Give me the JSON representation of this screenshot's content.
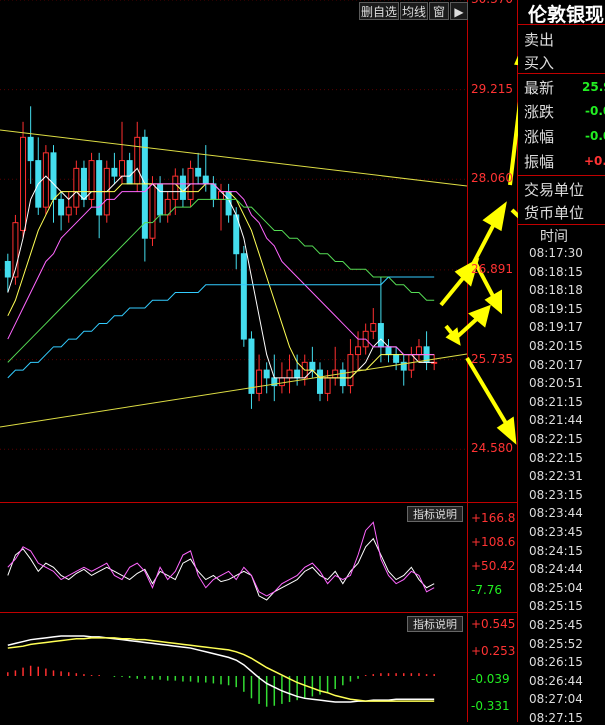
{
  "toolbar": {
    "remove_watch": "删自选",
    "ma": "均线",
    "window": "窗"
  },
  "price_axis": [
    "30.370",
    "29.215",
    "28.060",
    "26.891",
    "25.735",
    "24.580"
  ],
  "quote": {
    "title": "伦敦银现",
    "sell": "卖出",
    "buy": "买入",
    "latest_label": "最新",
    "latest_value": "25.9",
    "change_label": "涨跌",
    "change_value": "-0.0",
    "pct_label": "涨幅",
    "pct_value": "-0.0",
    "amp_label": "振幅",
    "amp_value": "+0.2",
    "unit_label": "交易单位",
    "currency_label": "货币单位"
  },
  "ticks": {
    "header": "时间",
    "times": [
      "08:17:30",
      "08:18:15",
      "08:18:18",
      "08:19:15",
      "08:19:17",
      "08:20:15",
      "08:20:17",
      "08:20:51",
      "08:21:15",
      "08:21:44",
      "08:22:15",
      "08:22:15",
      "08:22:31",
      "08:23:15",
      "08:23:44",
      "08:23:45",
      "08:24:15",
      "08:24:44",
      "08:25:04",
      "08:25:15",
      "08:25:45",
      "08:25:52",
      "08:26:15",
      "08:26:44",
      "08:27:04",
      "08:27:15"
    ]
  },
  "indicator_tag": "指标说明",
  "chart_data": [
    {
      "type": "candlestick",
      "ylim": [
        23.9,
        30.37
      ],
      "yticks": [
        30.37,
        29.215,
        28.06,
        26.891,
        25.735,
        24.58
      ],
      "candles": [
        [
          27.0,
          27.1,
          26.6,
          26.8
        ],
        [
          26.8,
          27.6,
          26.7,
          27.5
        ],
        [
          27.4,
          28.8,
          27.3,
          28.6
        ],
        [
          28.6,
          29.0,
          28.0,
          28.3
        ],
        [
          28.3,
          28.6,
          27.6,
          27.7
        ],
        [
          27.7,
          28.5,
          27.6,
          28.4
        ],
        [
          28.4,
          28.5,
          27.5,
          27.8
        ],
        [
          27.8,
          27.9,
          27.4,
          27.6
        ],
        [
          27.6,
          27.9,
          27.5,
          27.7
        ],
        [
          27.7,
          28.3,
          27.6,
          28.2
        ],
        [
          28.2,
          28.3,
          27.7,
          27.8
        ],
        [
          27.8,
          28.4,
          27.7,
          28.3
        ],
        [
          28.3,
          28.4,
          27.3,
          27.6
        ],
        [
          27.6,
          28.3,
          27.5,
          28.2
        ],
        [
          28.2,
          28.4,
          28.0,
          28.1
        ],
        [
          28.1,
          28.8,
          28.0,
          28.3
        ],
        [
          28.3,
          28.4,
          28.0,
          28.0
        ],
        [
          28.0,
          28.8,
          27.9,
          28.6
        ],
        [
          28.6,
          28.7,
          27.0,
          27.3
        ],
        [
          27.3,
          28.1,
          27.2,
          28.0
        ],
        [
          28.0,
          28.1,
          27.5,
          27.6
        ],
        [
          27.6,
          27.9,
          27.5,
          27.8
        ],
        [
          27.8,
          28.2,
          27.6,
          28.1
        ],
        [
          28.1,
          28.2,
          27.7,
          27.8
        ],
        [
          27.8,
          28.3,
          27.7,
          28.2
        ],
        [
          28.2,
          28.4,
          28.0,
          28.1
        ],
        [
          28.1,
          28.5,
          27.9,
          28.0
        ],
        [
          28.0,
          28.1,
          27.7,
          27.8
        ],
        [
          27.8,
          28.0,
          27.4,
          27.9
        ],
        [
          27.9,
          28.0,
          27.5,
          27.6
        ],
        [
          27.6,
          27.7,
          26.9,
          27.1
        ],
        [
          27.1,
          27.2,
          25.9,
          26.0
        ],
        [
          26.0,
          26.1,
          25.1,
          25.3
        ],
        [
          25.3,
          25.8,
          25.2,
          25.6
        ],
        [
          25.6,
          25.7,
          25.3,
          25.5
        ],
        [
          25.5,
          25.8,
          25.2,
          25.4
        ],
        [
          25.4,
          25.7,
          25.3,
          25.5
        ],
        [
          25.5,
          25.8,
          25.3,
          25.6
        ],
        [
          25.6,
          25.8,
          25.4,
          25.5
        ],
        [
          25.5,
          25.8,
          25.4,
          25.7
        ],
        [
          25.7,
          25.9,
          25.5,
          25.6
        ],
        [
          25.6,
          25.7,
          25.2,
          25.3
        ],
        [
          25.3,
          25.6,
          25.2,
          25.5
        ],
        [
          25.5,
          25.9,
          25.4,
          25.6
        ],
        [
          25.6,
          25.7,
          25.3,
          25.4
        ],
        [
          25.4,
          26.0,
          25.3,
          25.8
        ],
        [
          25.8,
          26.1,
          25.6,
          25.9
        ],
        [
          25.9,
          26.2,
          25.8,
          26.1
        ],
        [
          26.1,
          26.4,
          26.0,
          26.2
        ],
        [
          26.2,
          26.8,
          25.7,
          25.9
        ],
        [
          25.9,
          26.0,
          25.7,
          25.8
        ],
        [
          25.8,
          25.9,
          25.6,
          25.7
        ],
        [
          25.7,
          25.8,
          25.4,
          25.6
        ],
        [
          25.6,
          25.9,
          25.5,
          25.8
        ],
        [
          25.8,
          26.0,
          25.7,
          25.9
        ],
        [
          25.9,
          26.1,
          25.6,
          25.7
        ],
        [
          25.7,
          25.8,
          25.6,
          25.7
        ]
      ],
      "ma_lines": [
        {
          "color": "#ffffff",
          "values": [
            26.6,
            26.9,
            27.3,
            27.8,
            28.0,
            28.1,
            28.0,
            27.9,
            27.8,
            27.9,
            27.8,
            27.9,
            27.9,
            27.9,
            28.0,
            28.1,
            28.1,
            28.2,
            28.0,
            28.0,
            27.9,
            27.9,
            27.9,
            27.9,
            28.0,
            28.0,
            28.0,
            28.0,
            27.9,
            27.8,
            27.6,
            27.3,
            26.8,
            26.3,
            25.8,
            25.5,
            25.5,
            25.5,
            25.5,
            25.5,
            25.6,
            25.5,
            25.5,
            25.5,
            25.5,
            25.5,
            25.6,
            25.7,
            25.9,
            26.0,
            25.9,
            25.9,
            25.8,
            25.8,
            25.7,
            25.7,
            25.7
          ]
        },
        {
          "color": "#ffff55",
          "values": [
            26.3,
            26.5,
            26.8,
            27.1,
            27.4,
            27.6,
            27.8,
            27.9,
            27.9,
            27.9,
            27.9,
            27.9,
            27.9,
            27.9,
            27.9,
            28.0,
            28.0,
            28.0,
            28.0,
            28.0,
            28.0,
            28.0,
            28.0,
            27.9,
            27.9,
            27.9,
            28.0,
            28.0,
            27.9,
            27.9,
            27.8,
            27.6,
            27.4,
            27.1,
            26.8,
            26.5,
            26.2,
            25.9,
            25.7,
            25.6,
            25.6,
            25.5,
            25.5,
            25.5,
            25.5,
            25.5,
            25.6,
            25.6,
            25.7,
            25.8,
            25.8,
            25.8,
            25.8,
            25.8,
            25.8,
            25.8,
            25.8
          ]
        },
        {
          "color": "#ff66ff",
          "values": [
            26.0,
            26.2,
            26.4,
            26.6,
            26.8,
            27.0,
            27.1,
            27.3,
            27.4,
            27.5,
            27.6,
            27.7,
            27.7,
            27.8,
            27.8,
            27.9,
            27.9,
            27.9,
            27.9,
            28.0,
            28.0,
            28.0,
            28.0,
            28.0,
            28.0,
            28.0,
            28.0,
            28.0,
            27.9,
            27.9,
            27.9,
            27.8,
            27.6,
            27.5,
            27.3,
            27.2,
            27.0,
            26.9,
            26.8,
            26.7,
            26.6,
            26.5,
            26.4,
            26.3,
            26.2,
            26.1,
            26.0,
            26.0,
            25.9,
            25.9,
            25.9,
            25.9,
            25.8,
            25.8,
            25.8,
            25.8,
            25.8
          ]
        },
        {
          "color": "#55dd55",
          "values": [
            25.7,
            25.8,
            25.9,
            26.0,
            26.1,
            26.2,
            26.3,
            26.4,
            26.5,
            26.6,
            26.7,
            26.8,
            26.9,
            27.0,
            27.1,
            27.2,
            27.3,
            27.4,
            27.5,
            27.5,
            27.6,
            27.6,
            27.7,
            27.7,
            27.7,
            27.8,
            27.8,
            27.8,
            27.8,
            27.8,
            27.8,
            27.7,
            27.7,
            27.6,
            27.5,
            27.4,
            27.4,
            27.3,
            27.3,
            27.2,
            27.2,
            27.1,
            27.1,
            27.0,
            27.0,
            26.9,
            26.9,
            26.9,
            26.8,
            26.8,
            26.8,
            26.7,
            26.7,
            26.6,
            26.6,
            26.5,
            26.5
          ]
        },
        {
          "color": "#33ccff",
          "values": [
            25.5,
            25.6,
            25.6,
            25.7,
            25.7,
            25.8,
            25.9,
            25.9,
            26.0,
            26.0,
            26.1,
            26.1,
            26.2,
            26.2,
            26.3,
            26.3,
            26.4,
            26.4,
            26.4,
            26.5,
            26.5,
            26.5,
            26.6,
            26.6,
            26.6,
            26.6,
            26.7,
            26.7,
            26.7,
            26.7,
            26.7,
            26.7,
            26.7,
            26.7,
            26.7,
            26.7,
            26.7,
            26.7,
            26.7,
            26.7,
            26.7,
            26.7,
            26.7,
            26.7,
            26.7,
            26.7,
            26.7,
            26.7,
            26.7,
            26.7,
            26.8,
            26.8,
            26.8,
            26.8,
            26.8,
            26.8,
            26.8
          ]
        }
      ]
    },
    {
      "type": "line",
      "ylim": [
        -30,
        190
      ],
      "yticks": [
        166.8,
        108.6,
        50.42,
        -7.76
      ],
      "series": [
        {
          "color": "#ffffff",
          "values": [
            30,
            80,
            95,
            70,
            40,
            60,
            50,
            30,
            20,
            35,
            45,
            30,
            40,
            50,
            40,
            30,
            20,
            35,
            45,
            10,
            40,
            30,
            20,
            60,
            70,
            40,
            20,
            30,
            15,
            20,
            30,
            40,
            30,
            -20,
            -30,
            -10,
            0,
            10,
            20,
            40,
            50,
            30,
            20,
            40,
            10,
            40,
            60,
            100,
            120,
            80,
            40,
            20,
            30,
            50,
            20,
            0,
            10
          ]
        },
        {
          "color": "#ff66ff",
          "values": [
            50,
            70,
            100,
            90,
            60,
            50,
            40,
            20,
            30,
            40,
            50,
            40,
            50,
            60,
            30,
            20,
            50,
            60,
            40,
            0,
            50,
            20,
            40,
            80,
            90,
            30,
            0,
            20,
            30,
            40,
            20,
            50,
            30,
            -10,
            -20,
            -10,
            10,
            20,
            30,
            50,
            60,
            40,
            10,
            30,
            20,
            30,
            80,
            140,
            160,
            70,
            30,
            10,
            20,
            40,
            30,
            -10,
            0
          ]
        }
      ]
    },
    {
      "type": "bar_line",
      "ylim": [
        -0.43,
        0.58
      ],
      "yticks": [
        0.545,
        0.253,
        -0.039,
        -0.331
      ],
      "bars": [
        0.04,
        0.06,
        0.09,
        0.11,
        0.1,
        0.08,
        0.06,
        0.05,
        0.04,
        0.03,
        0.02,
        0.01,
        0.01,
        0.0,
        -0.01,
        -0.01,
        -0.02,
        -0.03,
        -0.03,
        -0.04,
        -0.04,
        -0.05,
        -0.05,
        -0.06,
        -0.06,
        -0.07,
        -0.07,
        -0.08,
        -0.09,
        -0.1,
        -0.12,
        -0.17,
        -0.24,
        -0.3,
        -0.33,
        -0.32,
        -0.3,
        -0.28,
        -0.26,
        -0.24,
        -0.22,
        -0.2,
        -0.18,
        -0.14,
        -0.1,
        -0.06,
        -0.03,
        0.01,
        0.02,
        0.03,
        0.03,
        0.03,
        0.03,
        0.03,
        0.03,
        0.02,
        0.02
      ],
      "series": [
        {
          "color": "#ffffff",
          "values": [
            0.33,
            0.35,
            0.37,
            0.39,
            0.4,
            0.41,
            0.42,
            0.43,
            0.43,
            0.43,
            0.43,
            0.42,
            0.42,
            0.41,
            0.4,
            0.39,
            0.38,
            0.37,
            0.36,
            0.35,
            0.34,
            0.33,
            0.32,
            0.31,
            0.3,
            0.28,
            0.26,
            0.24,
            0.22,
            0.2,
            0.17,
            0.12,
            0.05,
            -0.02,
            -0.08,
            -0.12,
            -0.16,
            -0.19,
            -0.22,
            -0.24,
            -0.25,
            -0.26,
            -0.27,
            -0.28,
            -0.28,
            -0.28,
            -0.27,
            -0.27,
            -0.26,
            -0.26,
            -0.26,
            -0.25,
            -0.25,
            -0.25,
            -0.25,
            -0.25,
            -0.25
          ]
        },
        {
          "color": "#ffff55",
          "values": [
            0.3,
            0.31,
            0.32,
            0.34,
            0.35,
            0.36,
            0.37,
            0.38,
            0.39,
            0.4,
            0.4,
            0.41,
            0.41,
            0.41,
            0.41,
            0.4,
            0.4,
            0.39,
            0.39,
            0.38,
            0.37,
            0.36,
            0.35,
            0.34,
            0.33,
            0.32,
            0.31,
            0.3,
            0.29,
            0.28,
            0.26,
            0.23,
            0.19,
            0.14,
            0.09,
            0.05,
            0.01,
            -0.03,
            -0.07,
            -0.1,
            -0.13,
            -0.16,
            -0.18,
            -0.21,
            -0.23,
            -0.25,
            -0.26,
            -0.27,
            -0.27,
            -0.27,
            -0.27,
            -0.27,
            -0.27,
            -0.27,
            -0.27,
            -0.27,
            -0.27
          ]
        }
      ]
    }
  ]
}
